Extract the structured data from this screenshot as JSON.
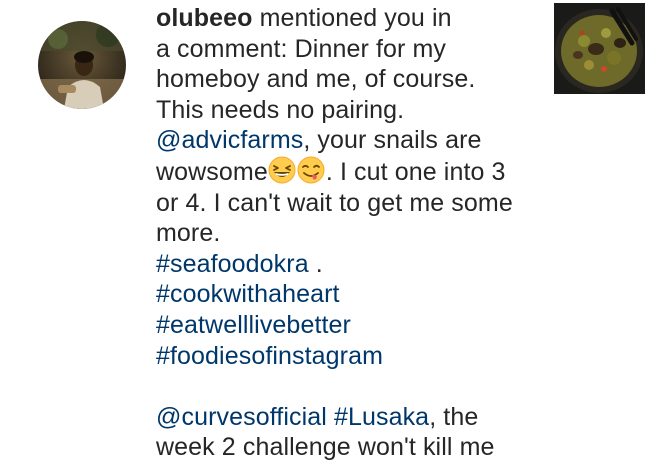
{
  "notification": {
    "username": "olubeeo",
    "action_text": "mentioned you in",
    "lines": {
      "l2": "a comment: Dinner for my",
      "l3": "homeboy and me, of course.",
      "l4": "This needs no pairing.",
      "l5_mention": "@advicfarms",
      "l5_rest": ", your snails are",
      "l6_word": "wowsome",
      "l6_rest": ". I cut one into 3",
      "l7": "or 4. I can't wait to get me some",
      "l8": "more.",
      "l9_tag": "#seafoodokra",
      "l9_rest": " .",
      "l10_tag": "#cookwithaheart",
      "l11_tag": "#eatwelllivebetter",
      "l12_tag": "#foodiesofinstagram",
      "l14_mention": "@curvesofficial",
      "l14_space": " ",
      "l14_tag": "#Lusaka",
      "l14_rest": ", the",
      "l15": "week 2 challenge won't kill me"
    },
    "emojis": [
      "grinning-squinting-face",
      "face-savoring-food"
    ],
    "colors": {
      "text": "#262626",
      "link": "#00376b",
      "background": "#ffffff"
    }
  }
}
